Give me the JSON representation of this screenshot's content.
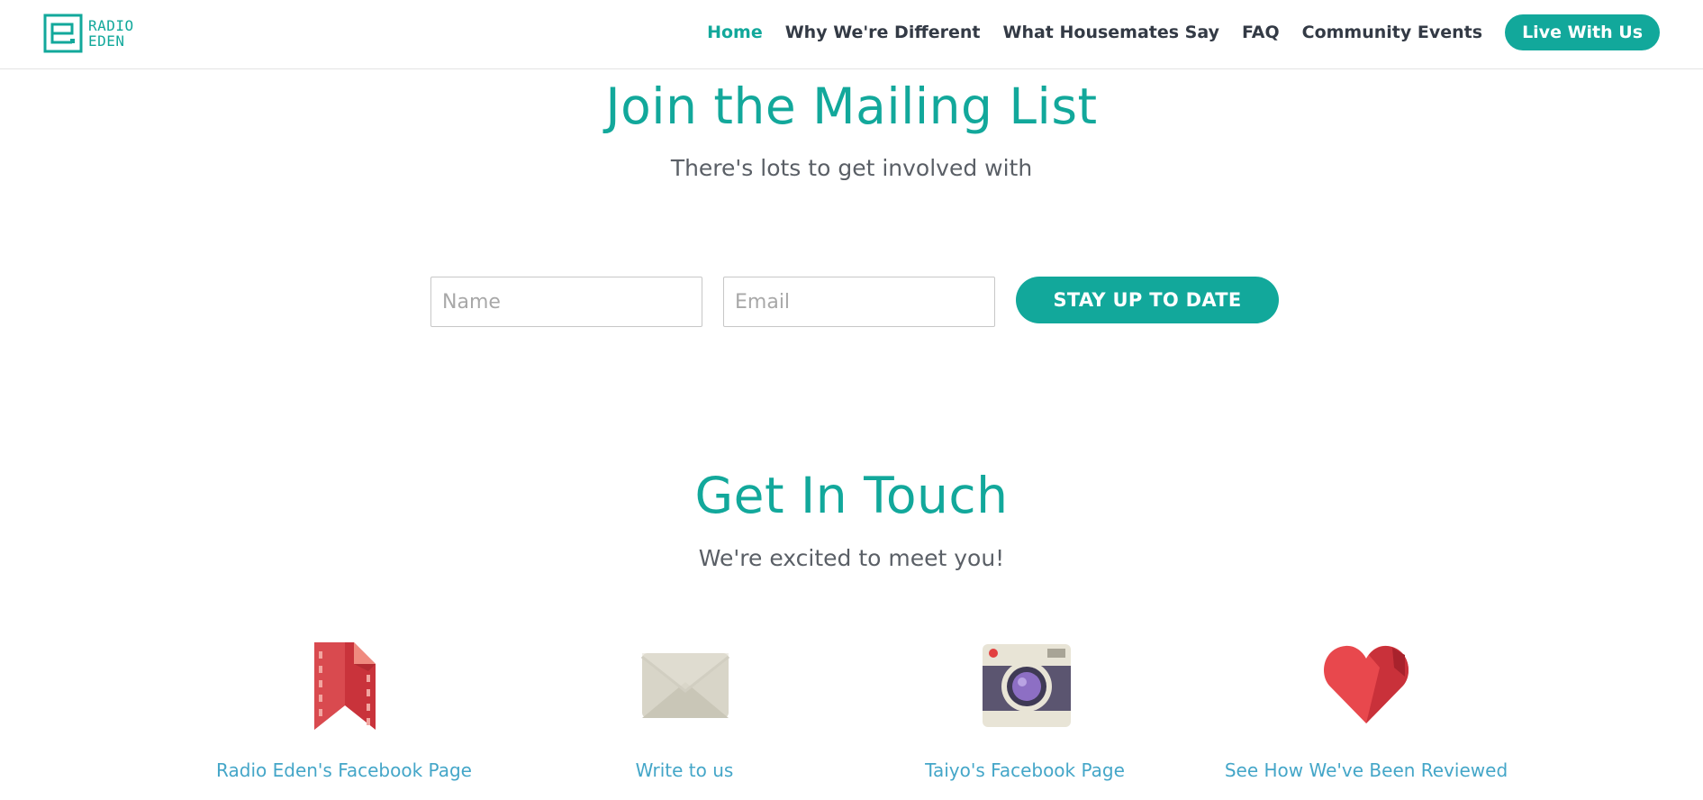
{
  "logo": {
    "line1": "RADIO",
    "line2": "EDEN",
    "color": "#12a89b"
  },
  "nav": {
    "items": [
      {
        "label": "Home",
        "active": true
      },
      {
        "label": "Why We're Different"
      },
      {
        "label": "What Housemates Say"
      },
      {
        "label": "FAQ"
      },
      {
        "label": "Community Events"
      }
    ],
    "cta_label": "Live With Us"
  },
  "mailing": {
    "title": "Join the Mailing List",
    "subtitle": "There's lots to get involved with",
    "name_placeholder": "Name",
    "email_placeholder": "Email",
    "name_value": "",
    "email_value": "",
    "submit_label": "STAY UP TO DATE"
  },
  "contact": {
    "title": "Get In Touch",
    "subtitle": "We're excited to meet you!",
    "cards": [
      {
        "icon": "bookmark-icon",
        "label": "Radio Eden's Facebook Page"
      },
      {
        "icon": "envelope-icon",
        "label": "Write to us"
      },
      {
        "icon": "camera-icon",
        "label": "Taiyo's Facebook Page"
      },
      {
        "icon": "heart-icon",
        "label": "See How We've Been Reviewed"
      }
    ]
  },
  "colors": {
    "accent": "#12a89b",
    "link": "#44a6c8",
    "nav_text": "#333a45"
  }
}
